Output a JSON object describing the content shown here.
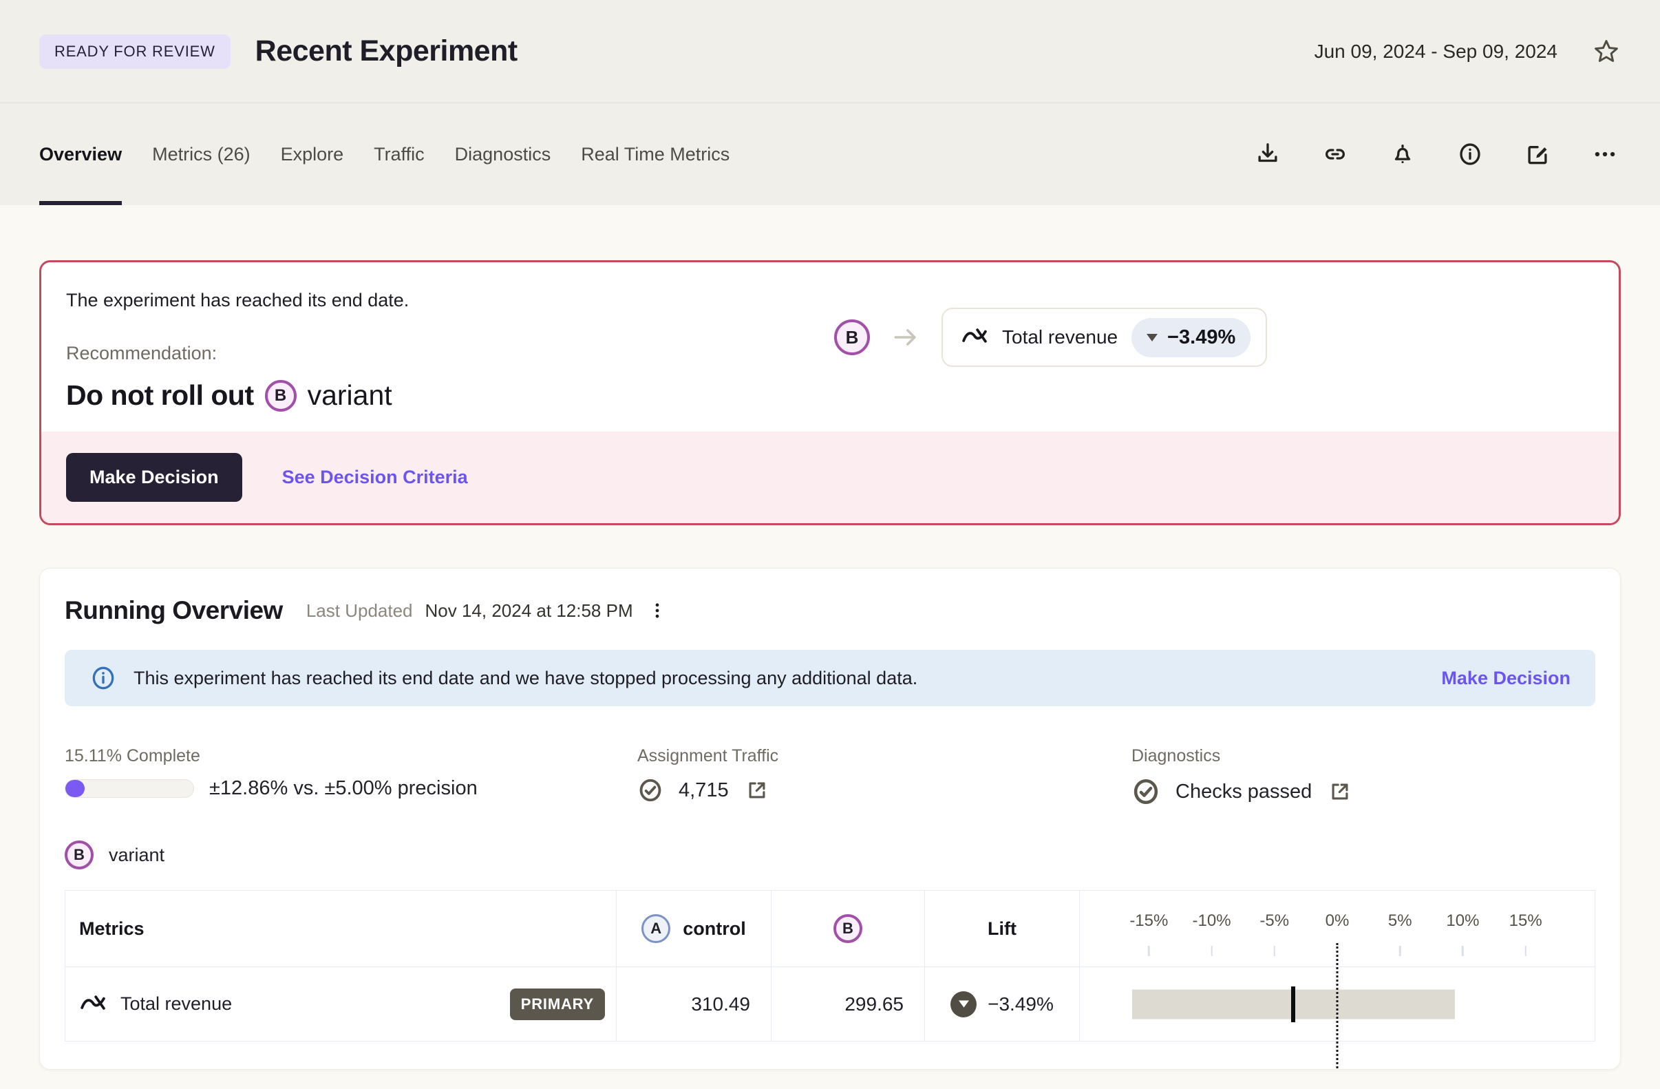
{
  "page": {
    "status_badge": "READY FOR REVIEW",
    "title": "Recent Experiment",
    "date_range": "Jun 09, 2024 - Sep 09, 2024"
  },
  "tabs": {
    "items": [
      {
        "label": "Overview",
        "active": true
      },
      {
        "label": "Metrics (26)",
        "active": false
      },
      {
        "label": "Explore",
        "active": false
      },
      {
        "label": "Traffic",
        "active": false
      },
      {
        "label": "Diagnostics",
        "active": false
      },
      {
        "label": "Real Time Metrics",
        "active": false
      }
    ],
    "action_icons": [
      "download-icon",
      "link-icon",
      "bell-icon",
      "info-icon",
      "edit-icon",
      "ellipsis-icon"
    ]
  },
  "recommendation": {
    "message": "The experiment has reached its end date.",
    "label": "Recommendation:",
    "action": "Do not roll out",
    "variant_letter": "B",
    "variant_word": "variant",
    "metric_chip": {
      "metric": "Total revenue",
      "delta": "−3.49%"
    },
    "make_decision_label": "Make Decision",
    "see_criteria_label": "See Decision Criteria"
  },
  "overview": {
    "title": "Running Overview",
    "last_updated_label": "Last Updated",
    "last_updated_value": "Nov 14, 2024 at 12:58 PM",
    "banner": {
      "text": "This experiment has reached its end date and we have stopped processing any additional data.",
      "action": "Make Decision"
    },
    "progress": {
      "label": "15.11% Complete",
      "percent": 15.11,
      "precision": "±12.86% vs. ±5.00% precision"
    },
    "assignment_traffic": {
      "label": "Assignment Traffic",
      "value": "4,715"
    },
    "diagnostics": {
      "label": "Diagnostics",
      "value": "Checks passed"
    },
    "variant": {
      "letter": "B",
      "name": "variant"
    }
  },
  "table": {
    "headers": {
      "metrics": "Metrics",
      "control_letter": "A",
      "control_label": "control",
      "variant_letter": "B",
      "lift": "Lift"
    },
    "axis": {
      "ticks": [
        "-15%",
        "-10%",
        "-5%",
        "0%",
        "5%",
        "10%",
        "15%"
      ],
      "tick_values": [
        -15,
        -10,
        -5,
        0,
        5,
        10,
        15
      ],
      "min": -20.5,
      "max": 20.5
    },
    "rows": [
      {
        "metric": "Total revenue",
        "tag": "PRIMARY",
        "control": "310.49",
        "variant": "299.65",
        "lift": "−3.49%",
        "lift_direction": "down",
        "estimate": -3.49,
        "ci_low": -16.35,
        "ci_high": 9.37
      }
    ]
  },
  "colors": {
    "accent_purple": "#6b55ee",
    "badge_lavender": "#e6e0f8",
    "alert_border_red": "#c64a5d",
    "alert_footer_pink": "#fceef0",
    "banner_blue": "#e3edf8",
    "banner_icon_blue": "#3671b5",
    "progress_purple": "#7a5af0",
    "variant_b_purple": "#a14fa8",
    "variant_a_blue": "#7b93c4",
    "olive_gray": "#5b574c",
    "ci_bar_gray": "#dcdad1",
    "dark_button": "#262135"
  }
}
